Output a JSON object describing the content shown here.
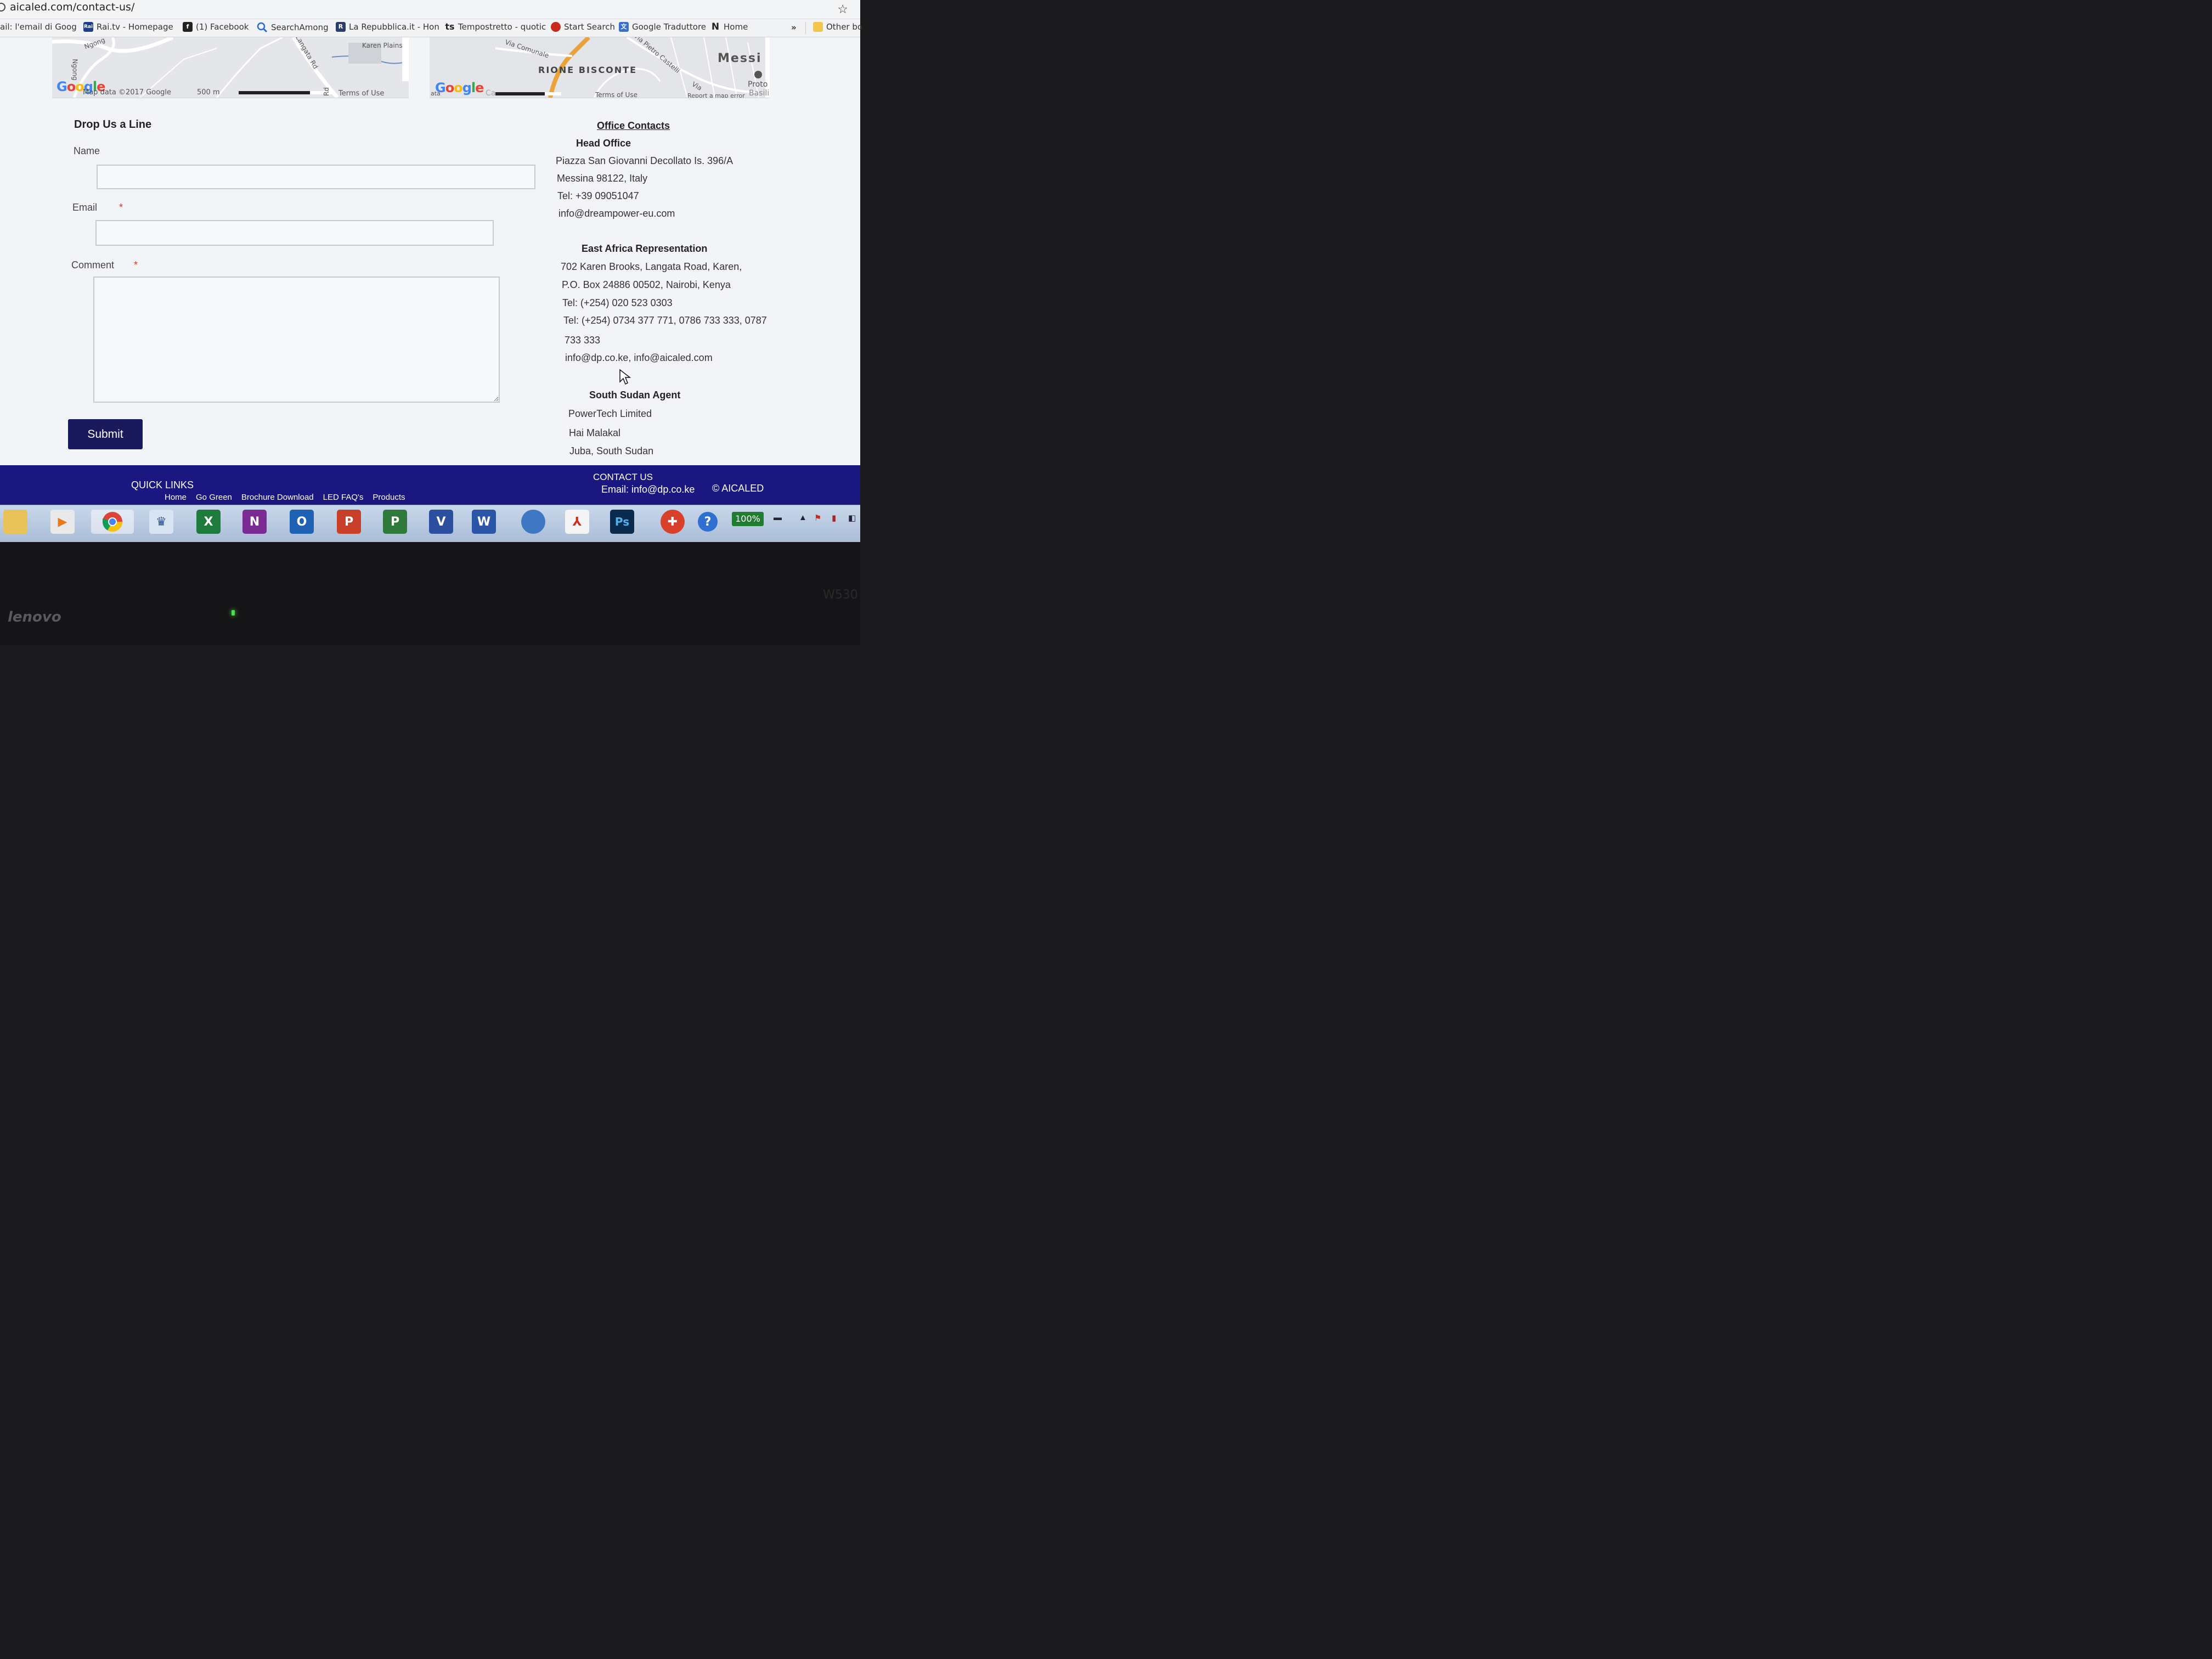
{
  "browser": {
    "url": "aicaled.com/contact-us/",
    "bookmarks": [
      {
        "label": "ail: l'email di Goog",
        "icon": "gmail-icon"
      },
      {
        "label": "Rai.tv - Homepage",
        "icon": "rai-icon",
        "icon_text": "Rai"
      },
      {
        "label": "(1) Facebook",
        "icon": "facebook-icon",
        "icon_text": "f"
      },
      {
        "label": "SearchAmong",
        "icon": "search-icon"
      },
      {
        "label": "La Repubblica.it - Hon",
        "icon": "repubblica-icon"
      },
      {
        "label": "Tempostretto - quotic",
        "icon": "tempostretto-icon",
        "icon_text": "ts"
      },
      {
        "label": "Start Search",
        "icon": "start-search-icon"
      },
      {
        "label": "Google Traduttore",
        "icon": "translate-icon"
      },
      {
        "label": "Home",
        "icon": "home-n-icon",
        "icon_text": "N"
      }
    ],
    "more": "»",
    "other_bookmarks": "Other bo"
  },
  "maps": {
    "map1": {
      "labels": [
        "Ngong",
        "Ngong",
        "Karen Plains",
        "Langata Rd",
        "Rd"
      ],
      "attribution": "Map data ©2017 Google",
      "scale": "500 m",
      "terms": "Terms of Use"
    },
    "map2": {
      "labels": [
        "Via Comunale",
        "RIONE BISCONTE",
        "Via Pietro Castelli",
        "Messi",
        "Proto",
        "Basili",
        "Via"
      ],
      "terms": "Terms of Use",
      "report": "Report a map error",
      "data_stub": "ata",
      "stub2": "Ca"
    }
  },
  "form": {
    "title": "Drop Us a Line",
    "name_label": "Name",
    "email_label": "Email",
    "comment_label": "Comment",
    "required_mark": "*",
    "submit_label": "Submit"
  },
  "contacts": {
    "title": "Office Contacts",
    "head_office": {
      "heading": "Head Office",
      "lines": [
        "Piazza San Giovanni Decollato Is. 396/A",
        "Messina 98122, Italy",
        "Tel: +39 09051047",
        "info@dreampower-eu.com"
      ]
    },
    "east_africa": {
      "heading": "East Africa Representation",
      "lines": [
        "702 Karen Brooks, Langata Road, Karen,",
        "P.O. Box 24886 00502, Nairobi, Kenya",
        "Tel: (+254) 020 523 0303",
        "Tel: (+254) 0734 377 771,  0786 733 333,  0787",
        "733 333",
        "info@dp.co.ke, info@aicaled.com"
      ]
    },
    "south_sudan": {
      "heading": "South Sudan Agent",
      "lines": [
        "PowerTech Limited",
        "Hai Malakal",
        "Juba, South Sudan"
      ]
    }
  },
  "footer": {
    "quick_links_title": "QUICK LINKS",
    "links": [
      "Home",
      "Go Green",
      "Brochure Download",
      "LED FAQ's",
      "Products"
    ],
    "contact_title": "CONTACT US",
    "email": "Email: info@dp.co.ke",
    "copyright": "© AICALED"
  },
  "taskbar": {
    "apps": [
      {
        "name": "file-explorer",
        "text": ""
      },
      {
        "name": "media-player",
        "text": "▶"
      },
      {
        "name": "chrome",
        "text": ""
      },
      {
        "name": "app-generic",
        "text": "♛"
      },
      {
        "name": "excel",
        "text": "X"
      },
      {
        "name": "onenote",
        "text": "N"
      },
      {
        "name": "outlook",
        "text": "O"
      },
      {
        "name": "powerpoint",
        "text": "P"
      },
      {
        "name": "project",
        "text": "P"
      },
      {
        "name": "visio",
        "text": "V"
      },
      {
        "name": "word",
        "text": "W"
      },
      {
        "name": "thunderbird",
        "text": ""
      },
      {
        "name": "acrobat",
        "text": "⅄"
      },
      {
        "name": "photoshop",
        "text": "Ps"
      },
      {
        "name": "office-tool",
        "text": "✚"
      },
      {
        "name": "help",
        "text": "?"
      }
    ],
    "battery": "100%"
  },
  "device": {
    "brand": "lenovo",
    "model": "W530"
  },
  "colors": {
    "submit_bg": "#19195c",
    "footer_bg": "#1a1880",
    "required": "#d9342b",
    "page_bg": "#f2f4f8"
  }
}
